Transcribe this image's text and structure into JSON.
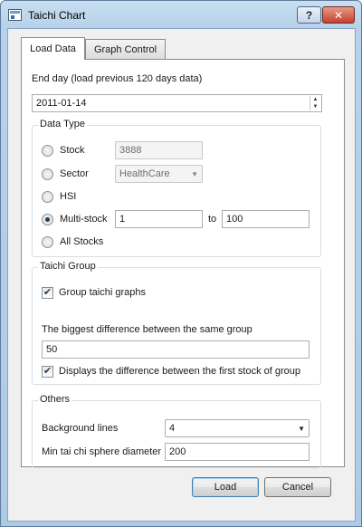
{
  "window": {
    "title": "Taichi Chart",
    "help_label": "?",
    "close_label": "✕"
  },
  "tabs": [
    {
      "label": "Load Data",
      "active": true
    },
    {
      "label": "Graph Control",
      "active": false
    }
  ],
  "end_day": {
    "label": "End day (load previous 120 days data)",
    "value": "2011-01-14"
  },
  "data_type": {
    "title": "Data Type",
    "stock": {
      "label": "Stock",
      "value": "3888"
    },
    "sector": {
      "label": "Sector",
      "value": "HealthCare"
    },
    "hsi": {
      "label": "HSI"
    },
    "multi_stock": {
      "label": "Multi-stock",
      "from": "1",
      "to_label": "to",
      "to": "100"
    },
    "all_stocks": {
      "label": "All Stocks"
    },
    "selected": "multi_stock"
  },
  "taichi_group": {
    "title": "Taichi Group",
    "group_graphs_label": "Group taichi graphs",
    "group_graphs_checked": true,
    "biggest_diff_label": "The biggest difference between the same group",
    "biggest_diff_value": "50",
    "display_diff_label": "Displays the difference between the first stock of group",
    "display_diff_checked": true
  },
  "others": {
    "title": "Others",
    "bg_lines_label": "Background lines",
    "bg_lines_value": "4",
    "min_diameter_label": "Min tai chi sphere diameter",
    "min_diameter_value": "200"
  },
  "buttons": {
    "load": "Load",
    "cancel": "Cancel"
  },
  "colors": {
    "titlebar": "#b7d2ea",
    "close": "#c6402c",
    "panel_bg": "#ffffff",
    "dialog_bg": "#f0f0f0"
  }
}
